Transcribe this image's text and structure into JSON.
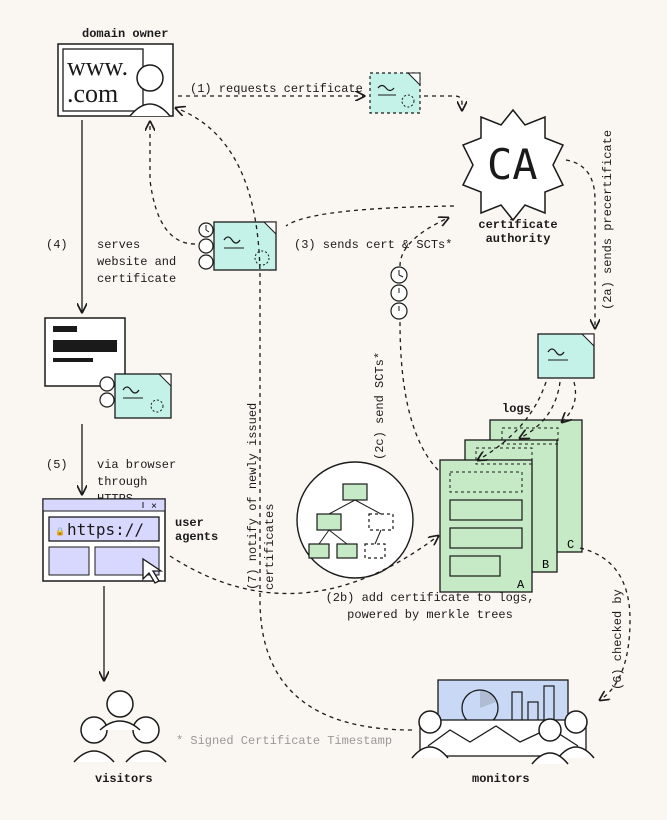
{
  "nodes": {
    "domain_owner": {
      "label": "domain owner",
      "url_text": "www. .com"
    },
    "ca": {
      "abbr": "CA",
      "label": "certificate authority"
    },
    "logs": {
      "label": "logs",
      "log_ids": [
        "A",
        "B",
        "C"
      ]
    },
    "monitors": {
      "label": "monitors"
    },
    "user_agents": {
      "label": "user agents",
      "url_bar": "https://"
    },
    "visitors": {
      "label": "visitors"
    }
  },
  "steps": {
    "1": "(1) requests certificate",
    "2a": "(2a) sends precertificate",
    "2b": "(2b) add certificate to logs, powered by merkle trees",
    "2c": "(2c) send SCTs*",
    "3": "(3) sends cert & SCTs*",
    "4": "(4) serves website and certificate",
    "5": "(5) via browser through HTTPS",
    "6": "(6) checked by",
    "7": "(7) notify of newly issued certificates"
  },
  "footnote": "* Signed Certificate Timestamp"
}
